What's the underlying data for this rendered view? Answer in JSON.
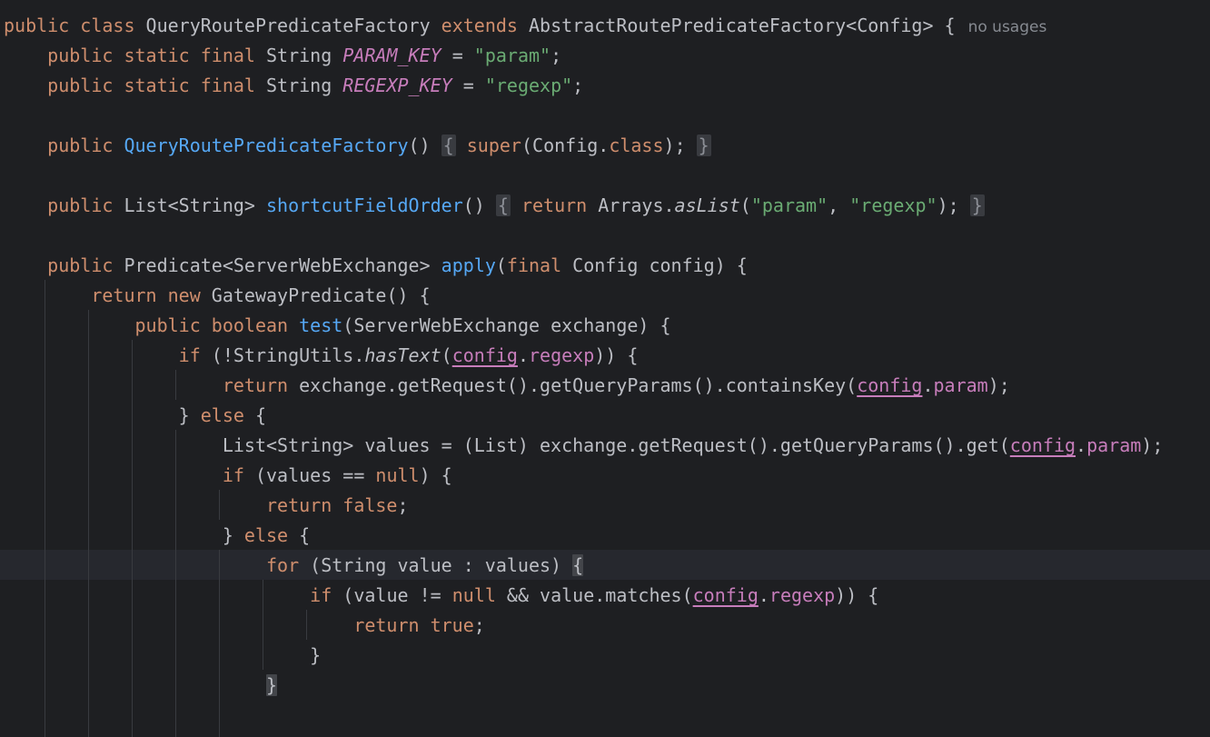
{
  "editor": {
    "inlay_hint": "no usages",
    "lines": [
      {
        "text": "public class QueryRoutePredicateFactory extends AbstractRoutePredicateFactory<Config> {"
      },
      {
        "text": "    public static final String PARAM_KEY = \"param\";"
      },
      {
        "text": "    public static final String REGEXP_KEY = \"regexp\";"
      },
      {
        "text": ""
      },
      {
        "text": "    public QueryRoutePredicateFactory() { super(Config.class); }"
      },
      {
        "text": ""
      },
      {
        "text": "    public List<String> shortcutFieldOrder() { return Arrays.asList(\"param\", \"regexp\"); }"
      },
      {
        "text": ""
      },
      {
        "text": "    public Predicate<ServerWebExchange> apply(final Config config) {"
      },
      {
        "text": "        return new GatewayPredicate() {"
      },
      {
        "text": "            public boolean test(ServerWebExchange exchange) {"
      },
      {
        "text": "                if (!StringUtils.hasText(config.regexp)) {"
      },
      {
        "text": "                    return exchange.getRequest().getQueryParams().containsKey(config.param);"
      },
      {
        "text": "                } else {"
      },
      {
        "text": "                    List<String> values = (List) exchange.getRequest().getQueryParams().get(config.param);"
      },
      {
        "text": "                    if (values == null) {"
      },
      {
        "text": "                        return false;"
      },
      {
        "text": "                    } else {"
      },
      {
        "text": "                        for (String value : values) {"
      },
      {
        "text": "                            if (value != null && value.matches(config.regexp)) {"
      },
      {
        "text": "                                return true;"
      },
      {
        "text": "                            }"
      },
      {
        "text": "                        }"
      }
    ],
    "current_line": 19,
    "colors": {
      "background": "#1e1f22",
      "keyword": "#cf8e6d",
      "string": "#6aab73",
      "function": "#56a8f5",
      "field": "#c77dbb",
      "default_text": "#bcbec4"
    }
  }
}
